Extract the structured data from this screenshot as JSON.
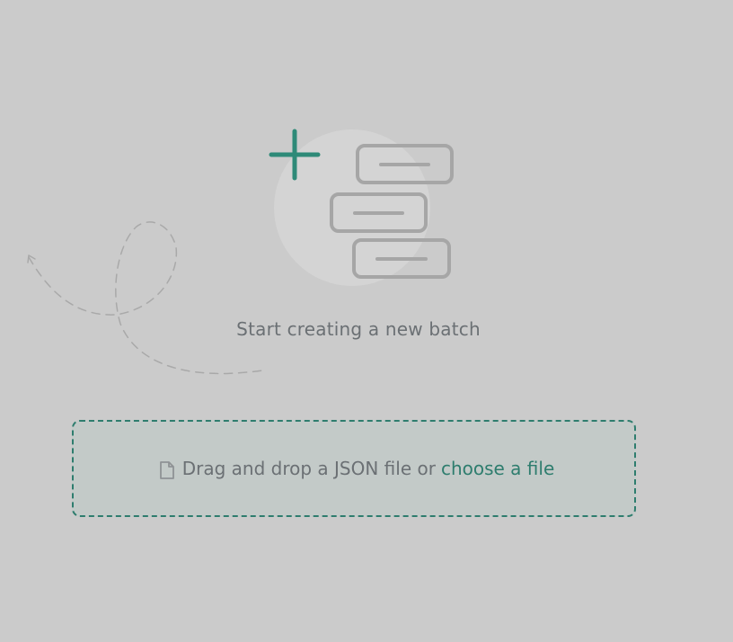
{
  "empty_state": {
    "title": "Start creating a new batch",
    "illustration_icon": "add-batch-stack-icon",
    "accent_color": "#2e8a78"
  },
  "dropzone": {
    "prompt_text": "Drag and drop a JSON file or",
    "link_text": "choose a file",
    "icon": "file-icon",
    "border_color": "#2e7d6e"
  }
}
